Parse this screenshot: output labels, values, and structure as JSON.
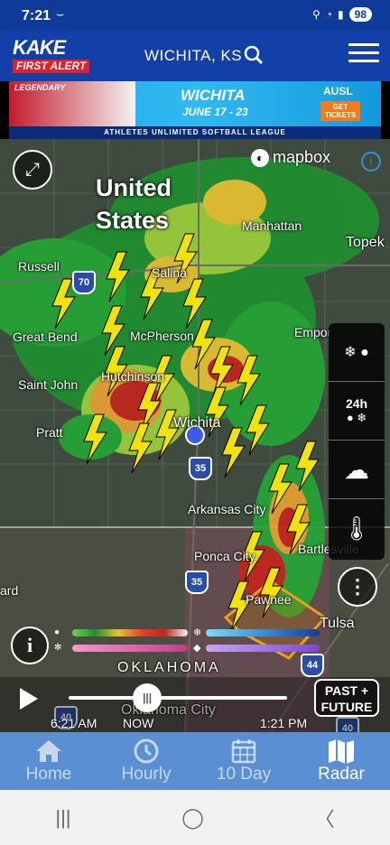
{
  "status_bar": {
    "time": "7:21",
    "battery": "98"
  },
  "header": {
    "logo_line1": "KAKE",
    "logo_line2": "FIRST ALERT",
    "location": "WICHITA, KS"
  },
  "ad": {
    "legendary": "LEGENDARY",
    "city": "WICHITA",
    "dates": "JUNE 17 - 23",
    "brand": "AUSL",
    "cta": "GET TICKETS",
    "tagline": "ATHLETES UNLIMITED SOFTBALL LEAGUE"
  },
  "map": {
    "attribution": "mapbox",
    "country_label_1": "United",
    "country_label_2": "States",
    "state_label": "OKLAHOMA",
    "cities": {
      "manhattan": "Manhattan",
      "topeka": "Topek",
      "russell": "Russell",
      "salina": "Salina",
      "great_bend": "Great Bend",
      "mcpherson": "McPherson",
      "emporia": "Empor",
      "saint_john": "Saint John",
      "hutchinson": "Hutchinson",
      "pratt": "Pratt",
      "wichita": "Wichita",
      "arkansas_city": "Arkansas City",
      "ponca_city": "Ponca City",
      "bartlesville": "Bartlesville",
      "ard": "ard",
      "pawnee": "Pawnee",
      "tulsa": "Tulsa",
      "oklahoma_city": "Oklahoma City"
    },
    "highways": {
      "i70": "70",
      "i35a": "35",
      "i35b": "35",
      "i44": "44",
      "i40a": "40",
      "i40b": "40"
    }
  },
  "layer_panel": {
    "forecast_label": "24h"
  },
  "timeline": {
    "start": "6:21 AM",
    "now": "NOW",
    "end": "1:21 PM",
    "past_future_1": "PAST +",
    "past_future_2": "FUTURE",
    "progress": 0.36
  },
  "tabs": [
    {
      "label": "Home",
      "icon": "home-icon",
      "active": false
    },
    {
      "label": "Hourly",
      "icon": "clock-icon",
      "active": false
    },
    {
      "label": "10 Day",
      "icon": "calendar-icon",
      "active": false
    },
    {
      "label": "Radar",
      "icon": "map-icon",
      "active": true
    }
  ],
  "colors": {
    "brand_blue": "#123fa8",
    "tab_bar": "#5a8fd4",
    "alert_red": "#e3202a"
  }
}
